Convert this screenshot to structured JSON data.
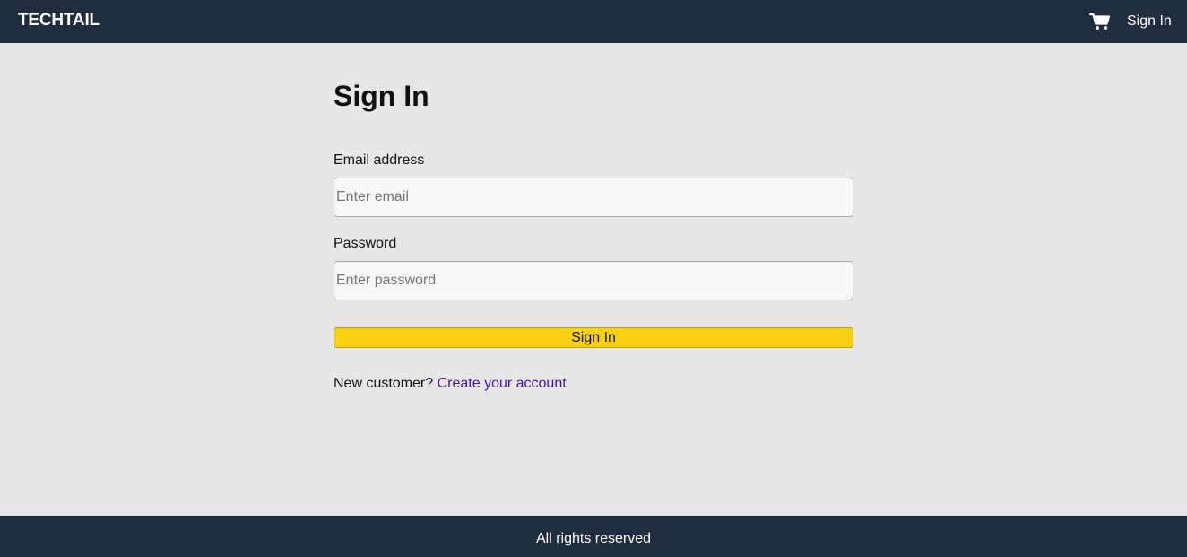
{
  "navbar": {
    "brand": "TECHTAIL",
    "cart_icon": "shopping-cart-icon",
    "signin_label": "Sign In"
  },
  "form": {
    "title": "Sign In",
    "email_label": "Email address",
    "email_placeholder": "Enter email",
    "email_value": "",
    "password_label": "Password",
    "password_placeholder": "Enter password",
    "password_value": "",
    "submit_label": "Sign In",
    "new_customer_prompt": "New customer?",
    "create_account_label": "Create your account"
  },
  "footer": {
    "text": "All rights reserved"
  },
  "colors": {
    "navbar_bg": "#202d3e",
    "page_bg": "#e7e7e7",
    "button_bg": "#f8d212",
    "link": "#4a12a8"
  }
}
